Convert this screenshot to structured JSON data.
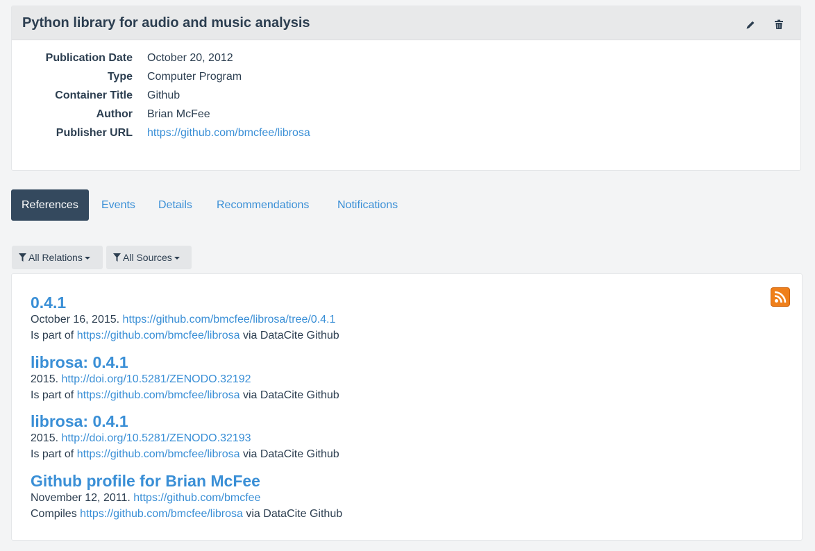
{
  "work": {
    "title": "Python library for audio and music analysis",
    "fields": [
      {
        "label": "Publication Date",
        "value": "October 20, 2012"
      },
      {
        "label": "Type",
        "value": "Computer Program"
      },
      {
        "label": "Container Title",
        "value": "Github"
      },
      {
        "label": "Author",
        "value": "Brian McFee"
      },
      {
        "label": "Publisher URL",
        "value": "https://github.com/bmcfee/librosa"
      }
    ]
  },
  "tabs": [
    "References",
    "Events",
    "Details",
    "Recommendations",
    "Notifications"
  ],
  "filters": {
    "relations": "All Relations",
    "sources": "All Sources"
  },
  "references": [
    {
      "title": "0.4.1",
      "date": "October 16, 2015.",
      "url": "https://github.com/bmcfee/librosa/tree/0.4.1",
      "relation": "Is part of",
      "target": "https://github.com/bmcfee/librosa",
      "via": "via DataCite Github"
    },
    {
      "title": "librosa: 0.4.1",
      "date": "2015.",
      "url": "http://doi.org/10.5281/ZENODO.32192",
      "relation": "Is part of",
      "target": "https://github.com/bmcfee/librosa",
      "via": "via DataCite Github"
    },
    {
      "title": "librosa: 0.4.1",
      "date": "2015.",
      "url": "http://doi.org/10.5281/ZENODO.32193",
      "relation": "Is part of",
      "target": "https://github.com/bmcfee/librosa",
      "via": "via DataCite Github"
    },
    {
      "title": "Github profile for Brian McFee",
      "date": "November 12, 2011.",
      "url": "https://github.com/bmcfee",
      "relation": "Compiles",
      "target": "https://github.com/bmcfee/librosa",
      "via": "via DataCite Github"
    }
  ],
  "icons": {
    "edit": "pencil-icon",
    "delete": "trash-icon",
    "filter": "filter-icon",
    "feed": "rss-icon"
  },
  "colors": {
    "link": "#3a8fd6",
    "active_tab": "#34495e",
    "rss": "#ef7f1a"
  }
}
